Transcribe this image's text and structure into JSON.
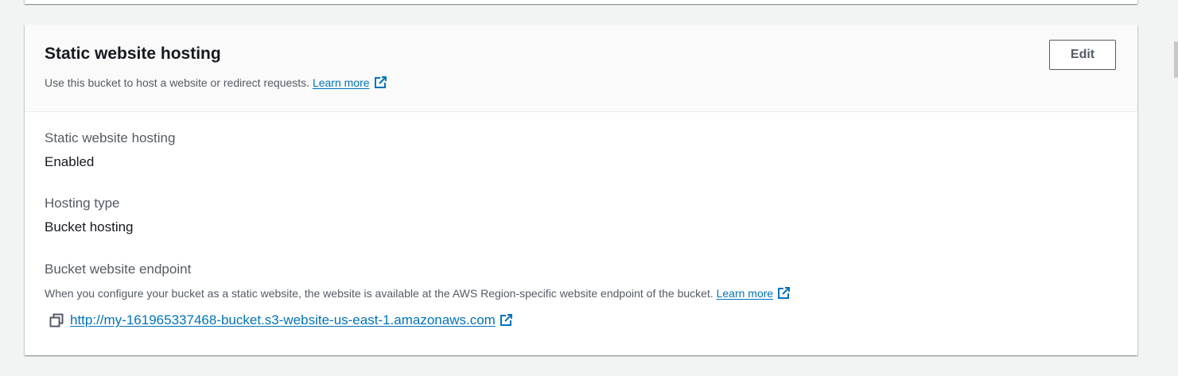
{
  "card": {
    "title": "Static website hosting",
    "description": "Use this bucket to host a website or redirect requests.",
    "learn_more": "Learn more",
    "edit_label": "Edit"
  },
  "fields": {
    "hosting_label": "Static website hosting",
    "hosting_value": "Enabled",
    "type_label": "Hosting type",
    "type_value": "Bucket hosting",
    "endpoint_label": "Bucket website endpoint",
    "endpoint_description": "When you configure your bucket as a static website, the website is available at the AWS Region-specific website endpoint of the bucket.",
    "endpoint_learn_more": "Learn more",
    "endpoint_url": "http://my-161965337468-bucket.s3-website-us-east-1.amazonaws.com"
  },
  "icons": {
    "external": "external-link-icon",
    "copy": "copy-icon"
  },
  "colors": {
    "link": "#0073bb",
    "text": "#16191f",
    "secondary_text": "#545b64",
    "header_bg": "#fafafa",
    "page_bg": "#f2f3f3"
  }
}
